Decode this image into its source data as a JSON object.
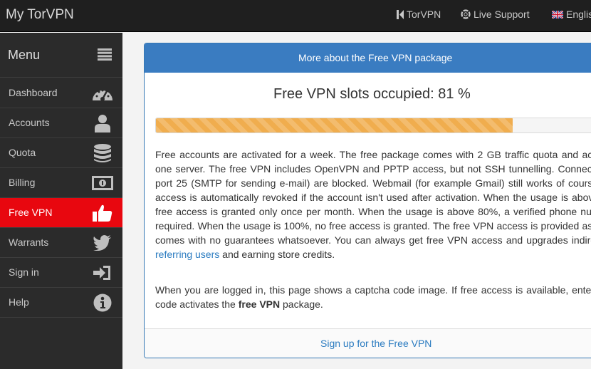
{
  "app": {
    "title": "My TorVPN"
  },
  "topnav": [
    {
      "label": "TorVPN",
      "icon": "torvpn-logo-icon"
    },
    {
      "label": "Live Support",
      "icon": "lifebuoy-icon"
    },
    {
      "label": "English",
      "icon": "uk-flag-icon"
    }
  ],
  "sidebar": {
    "menu_label": "Menu",
    "items": [
      {
        "label": "Dashboard",
        "icon": "dashboard-gauge-icon",
        "active": false
      },
      {
        "label": "Accounts",
        "icon": "user-icon",
        "active": false
      },
      {
        "label": "Quota",
        "icon": "database-icon",
        "active": false
      },
      {
        "label": "Billing",
        "icon": "money-bill-icon",
        "active": false
      },
      {
        "label": "Free VPN",
        "icon": "thumbs-up-icon",
        "active": true
      },
      {
        "label": "Warrants",
        "icon": "twitter-bird-icon",
        "active": false
      },
      {
        "label": "Sign in",
        "icon": "sign-in-icon",
        "active": false
      },
      {
        "label": "Help",
        "icon": "info-icon",
        "active": false
      }
    ]
  },
  "panel": {
    "header": "More about the Free VPN package",
    "slots_title": "Free VPN slots occupied: 81 %",
    "progress_fraction": 0.81,
    "para1_before_link": "Free accounts are activated for a week. The free package comes with 2 GB traffic quota and access to one server. The free VPN includes OpenVPN and PPTP access, but not SSH tunnelling. Connections to port 25 (SMTP for sending e-mail) are blocked. Webmail (for example Gmail) still works of course. Free access is automatically revoked if the account isn't used after activation. When the usage is above 50%, free access is granted only once per month. When the usage is above 80%, a verified phone number is required. When the usage is 100%, no free access is granted. The free VPN access is provided as is, and comes with no guarantees whatsoever. You can always get free VPN access and upgrades indirectly by ",
    "para1_link": "referring users",
    "para1_after_link": " and earning store credits.",
    "para2_before_bold": "When you are logged in, this page shows a captcha code image. If free access is available, entering the code activates the ",
    "para2_bold": "free VPN",
    "para2_after_bold": " package.",
    "footer_link": "Sign up for the Free VPN"
  },
  "colors": {
    "topbar": "#1f1f1f",
    "sidebar": "#2b2b2b",
    "active_item": "#e8070f",
    "panel_header": "#3a7cc1",
    "progress": "#f0ad4e",
    "link": "#2a7bc0"
  }
}
